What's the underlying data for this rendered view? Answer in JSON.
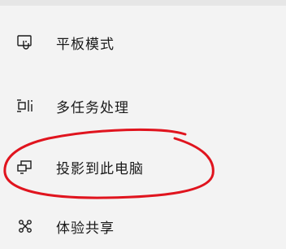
{
  "menu": {
    "items": [
      {
        "label": "平板模式",
        "icon": "tablet-mode-icon"
      },
      {
        "label": "多任务处理",
        "icon": "multitasking-icon"
      },
      {
        "label": "投影到此电脑",
        "icon": "project-to-pc-icon"
      },
      {
        "label": "体验共享",
        "icon": "shared-experiences-icon"
      }
    ]
  },
  "annotation": {
    "color": "#e0141e"
  }
}
